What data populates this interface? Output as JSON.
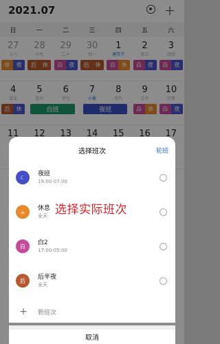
{
  "calendar": {
    "title": "2021.07",
    "weekdays": [
      "日",
      "一",
      "二",
      "三",
      "四",
      "五",
      "六"
    ],
    "week1": [
      {
        "num": "27",
        "sub": "十八",
        "shift": "休|夜",
        "style": "s-rest-night"
      },
      {
        "num": "28",
        "sub": "十九",
        "shift": "后|休",
        "style": "s-post"
      },
      {
        "num": "29",
        "sub": "二十",
        "shift": "白|夜",
        "style": "s-white-night"
      },
      {
        "num": "30",
        "sub": "廿一",
        "shift": "后|休",
        "style": "s-post"
      },
      {
        "num": "1",
        "sub": "建党节",
        "shift": "白|休",
        "style": "s-white-rest"
      },
      {
        "num": "2",
        "sub": "廿三",
        "shift": "白|夜",
        "style": "s-white-night"
      },
      {
        "num": "3",
        "sub": "廿四",
        "shift": "白|夜",
        "style": "s-white-night"
      }
    ],
    "week2": [
      {
        "num": "4",
        "sub": "廿五",
        "shift": "后|休",
        "style": "s-post-night"
      },
      {
        "num": "5",
        "sub": "廿六",
        "shift": "白|白",
        "style": "s-white"
      },
      {
        "num": "6",
        "sub": "廿七",
        "shift": "",
        "style": ""
      },
      {
        "num": "7",
        "sub": "小暑",
        "shift": "夜班",
        "style": "s-night"
      },
      {
        "num": "8",
        "sub": "廿九",
        "shift": "",
        "style": ""
      },
      {
        "num": "9",
        "sub": "三十",
        "shift": "白|休",
        "style": "s-white-rest"
      },
      {
        "num": "10",
        "sub": "六月",
        "shift": "白|夜",
        "style": "s-white-night"
      }
    ],
    "week2_wide": [
      {
        "label": "白班",
        "color": "green"
      },
      {
        "label": "夜班",
        "color": "blue2"
      }
    ],
    "week3": [
      "11",
      "12",
      "13",
      "14",
      "15",
      "16",
      "17"
    ]
  },
  "sheet": {
    "title": "选择班次",
    "action": "轮班",
    "options": [
      {
        "name": "夜班",
        "time": "19:00-07:00",
        "icon": "moon-icon",
        "glyph": "☾"
      },
      {
        "name": "休息",
        "time": "全天",
        "icon": "coffee-icon",
        "glyph": "☕"
      },
      {
        "name": "白2",
        "time": "17:00-05:00",
        "icon": "white-shift-icon",
        "glyph": "白"
      },
      {
        "name": "后半夜",
        "time": "全天",
        "icon": "late-night-icon",
        "glyph": "后"
      }
    ],
    "hint": "选择实际班次",
    "new_shift": "新班次",
    "cancel": "取消"
  },
  "colors": {
    "night": "#4450c8",
    "rest": "#e8892b",
    "white": "#c64a9a",
    "post": "#b8582f",
    "accent": "#2f6fd6",
    "hint": "#e0242a"
  }
}
